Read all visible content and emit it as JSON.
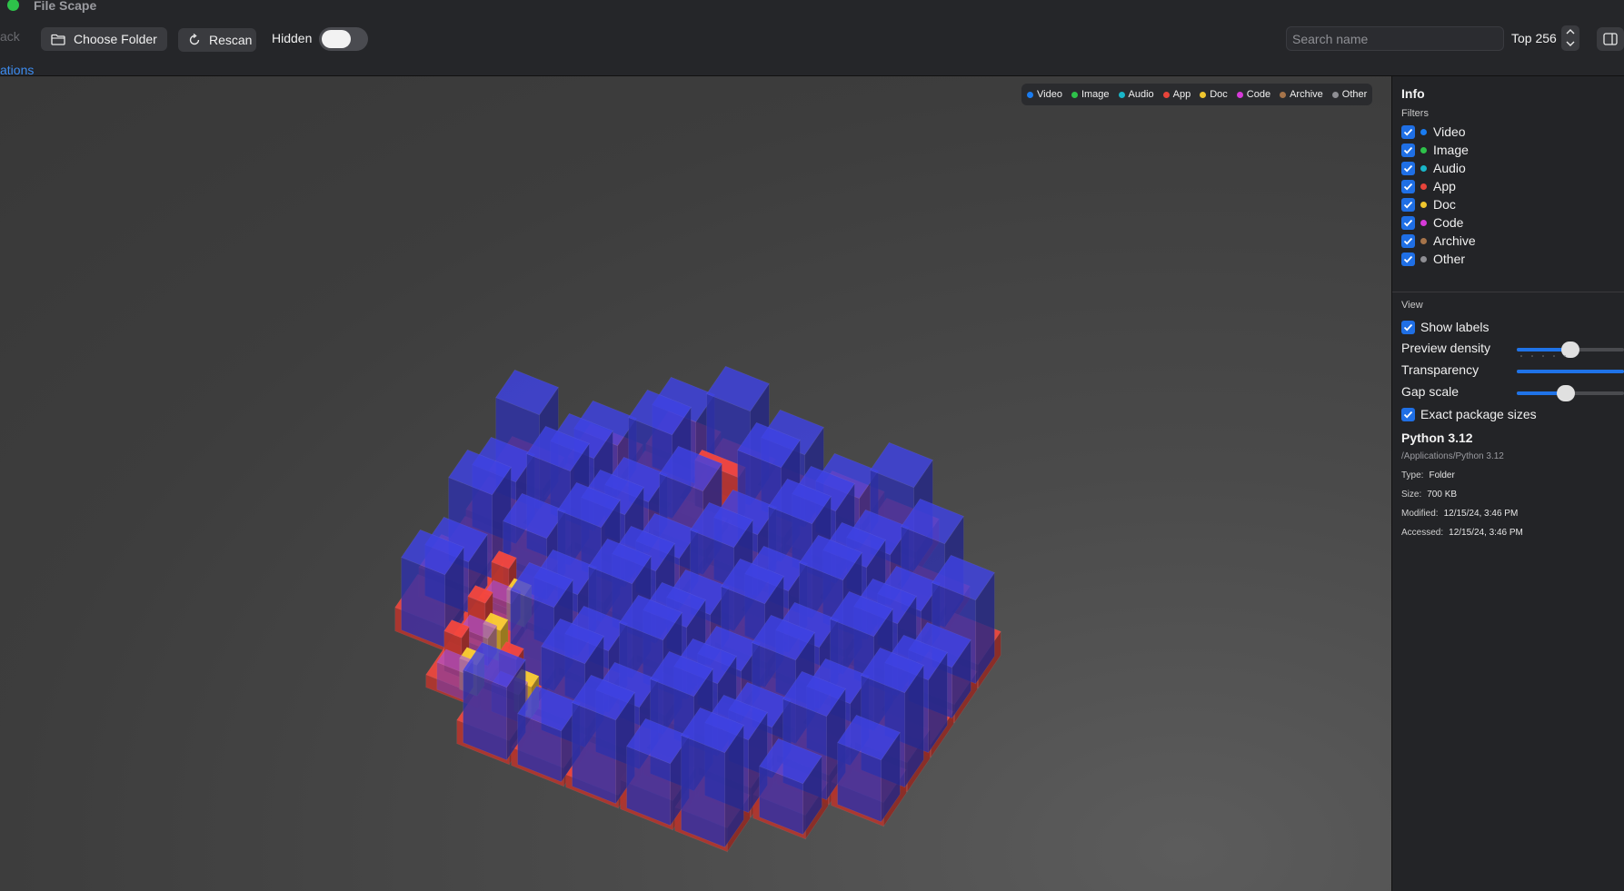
{
  "window": {
    "title": "File Scape"
  },
  "toolbar": {
    "back_label": "ack",
    "choose_folder_label": "Choose Folder",
    "rescan_label": "Rescan",
    "hidden_label": "Hidden",
    "hidden_on": false,
    "search_placeholder": "Search name",
    "top_label": "Top 256"
  },
  "breadcrumb": {
    "current": "ations"
  },
  "legend": {
    "items": [
      {
        "label": "Video",
        "color": "#1a7cf0"
      },
      {
        "label": "Image",
        "color": "#2ec24a"
      },
      {
        "label": "Audio",
        "color": "#19b6c8"
      },
      {
        "label": "App",
        "color": "#e8443a"
      },
      {
        "label": "Doc",
        "color": "#f0c62e"
      },
      {
        "label": "Code",
        "color": "#d63ad8"
      },
      {
        "label": "Archive",
        "color": "#a6744a"
      },
      {
        "label": "Other",
        "color": "#8e8e93"
      }
    ]
  },
  "panel": {
    "title": "Info",
    "filters_label": "Filters",
    "filters": [
      {
        "label": "Video",
        "color": "#1a7cf0",
        "checked": true
      },
      {
        "label": "Image",
        "color": "#2ec24a",
        "checked": true
      },
      {
        "label": "Audio",
        "color": "#19b6c8",
        "checked": true
      },
      {
        "label": "App",
        "color": "#e8443a",
        "checked": true
      },
      {
        "label": "Doc",
        "color": "#f0c62e",
        "checked": true
      },
      {
        "label": "Code",
        "color": "#d63ad8",
        "checked": true
      },
      {
        "label": "Archive",
        "color": "#a6744a",
        "checked": true
      },
      {
        "label": "Other",
        "color": "#8e8e93",
        "checked": true
      }
    ],
    "view_label": "View",
    "show_labels": "Show labels",
    "preview_density": {
      "label": "Preview density",
      "value": 0.5
    },
    "transparency": {
      "label": "Transparency",
      "value": 1.0
    },
    "gap_scale": {
      "label": "Gap scale",
      "value": 0.46
    },
    "exact_package_sizes": "Exact package sizes"
  },
  "selection": {
    "name": "Python 3.12",
    "path": "/Applications/Python 3.12",
    "type_label": "Type:",
    "type": "Folder",
    "size_label": "Size:",
    "size": "700 KB",
    "modified_label": "Modified:",
    "modified": "12/15/24, 3:46 PM",
    "accessed_label": "Accessed:",
    "accessed": "12/15/24, 3:46 PM"
  },
  "colors": {
    "accent": "#1f73e8",
    "folder_block": "#e8443a",
    "file_block": "#3b3fd8"
  }
}
